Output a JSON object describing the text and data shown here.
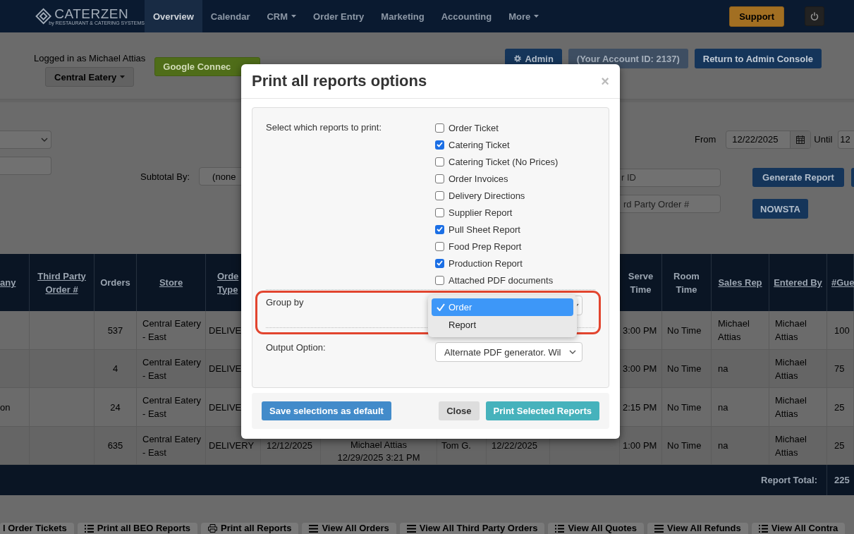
{
  "navbar": {
    "logo": "CATERZEN",
    "tagline": "by RESTAURANT & CATERING SYSTEMS",
    "items": [
      {
        "label": "Overview",
        "selected": true,
        "dropdown": false
      },
      {
        "label": "Calendar",
        "selected": false,
        "dropdown": false
      },
      {
        "label": "CRM",
        "selected": false,
        "dropdown": true
      },
      {
        "label": "Order Entry",
        "selected": false,
        "dropdown": false
      },
      {
        "label": "Marketing",
        "selected": false,
        "dropdown": false
      },
      {
        "label": "Accounting",
        "selected": false,
        "dropdown": false
      },
      {
        "label": "More",
        "selected": false,
        "dropdown": true
      }
    ],
    "support": "Support"
  },
  "header": {
    "logged_in": "Logged in as Michael Attias",
    "store": "Central Eatery",
    "google": "Google Connec",
    "admin": "Admin",
    "account_id": "(Your Account ID: 2137)",
    "return": "Return to Admin Console"
  },
  "filters": {
    "from_label": "From",
    "from_value": "12/22/2025",
    "until_label": "Until",
    "until_value": "12",
    "subtotal_label": "Subtotal By:",
    "subtotal_value": "(none",
    "order_id_placeholder": "r ID",
    "third_party_placeholder": "rd Party Order #",
    "generate": "Generate Report",
    "nowsta": "NOWSTA"
  },
  "table": {
    "columns": [
      {
        "label": "any",
        "link": true
      },
      {
        "label": "Third Party Order #",
        "link": true
      },
      {
        "label": "Orders",
        "link": false
      },
      {
        "label": "Store",
        "link": true
      },
      {
        "label": "Orde\nType",
        "link": true
      },
      null,
      null,
      null,
      null,
      null,
      {
        "label": "Serve Time",
        "link": false
      },
      {
        "label": "Room Time",
        "link": false
      },
      {
        "label": "Sales Rep",
        "link": true
      },
      {
        "label": "Entered By",
        "link": true
      },
      {
        "label": "#Gue",
        "link": true
      }
    ],
    "rows": [
      [
        null,
        null,
        "537",
        "Central Eatery - East",
        "DELIVE",
        null,
        null,
        null,
        null,
        null,
        "3:00 PM",
        "No Time",
        "Michael Attias",
        "Michael Attias",
        "100"
      ],
      [
        null,
        null,
        "4",
        "Central Eatery - East",
        "DELIVE",
        null,
        null,
        null,
        null,
        null,
        "3:00 PM",
        "No Time",
        "na",
        "Michael Attias",
        "75"
      ],
      [
        "on",
        null,
        "24",
        "Central Eatery - East",
        "DELIVE",
        null,
        null,
        null,
        null,
        null,
        "2:15 PM",
        "No Time",
        "na",
        "Michael Attias",
        "25"
      ],
      [
        null,
        null,
        "635",
        "Central Eatery - East",
        "DELIVERY",
        "12/12/2025",
        "Michael Attias\n12/29/2025 3:21 PM",
        "Tom G.",
        "12/22/2025",
        null,
        "1:00 PM",
        "No Time",
        "na",
        "Michael Attias",
        "25"
      ]
    ],
    "total_label": "Report Total:",
    "total_guests": "225"
  },
  "bottom_buttons": [
    {
      "label": "l Order Tickets"
    },
    {
      "label": "Print all BEO Reports",
      "kind": "list"
    },
    {
      "label": "Print all Reports",
      "kind": "print"
    },
    {
      "label": "View All Orders",
      "kind": "lines"
    },
    {
      "label": "View All Third Party Orders",
      "kind": "lines"
    },
    {
      "label": "View All Quotes",
      "kind": "list"
    },
    {
      "label": "View All Refunds",
      "kind": "lines"
    },
    {
      "label": "View All Contra",
      "kind": "list"
    }
  ],
  "modal": {
    "title": "Print all reports options",
    "close": "×",
    "reports_label": "Select which reports to print:",
    "reports": [
      {
        "label": "Order Ticket",
        "checked": false
      },
      {
        "label": "Catering Ticket",
        "checked": true
      },
      {
        "label": "Catering Ticket (No Prices)",
        "checked": false
      },
      {
        "label": "Order Invoices",
        "checked": false
      },
      {
        "label": "Delivery Directions",
        "checked": false
      },
      {
        "label": "Supplier Report",
        "checked": false
      },
      {
        "label": "Pull Sheet Report",
        "checked": true
      },
      {
        "label": "Food Prep Report",
        "checked": false
      },
      {
        "label": "Production Report",
        "checked": true
      },
      {
        "label": "Attached PDF documents",
        "checked": false
      }
    ],
    "group_by": {
      "label": "Group by",
      "highlighted": true,
      "expanded": true,
      "options": [
        {
          "label": "Order",
          "selected": true
        },
        {
          "label": "Report",
          "selected": false
        }
      ]
    },
    "output": {
      "label": "Output Option:",
      "value": "Alternate PDF generator. Wil"
    },
    "buttons": [
      {
        "label": "Save selections as default",
        "kind": "primary"
      },
      {
        "label": "Close",
        "kind": "default"
      },
      {
        "label": "Print Selected Reports",
        "kind": "info"
      }
    ]
  }
}
